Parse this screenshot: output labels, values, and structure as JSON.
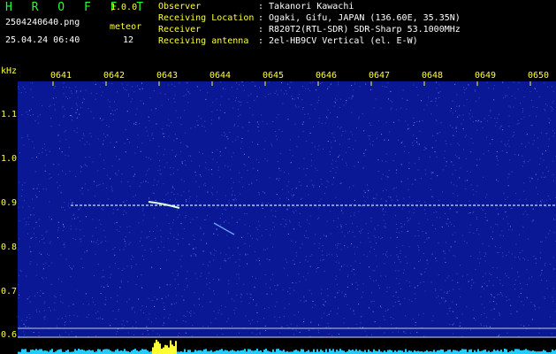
{
  "header": {
    "app_name": "H R O F F T",
    "version": "1.0.0",
    "filename": "2504240640.png",
    "meteor_label": "meteor",
    "datetime": "25.04.24 06:40",
    "meteor_count": "12",
    "info": [
      {
        "key": "Observer",
        "value": ": Takanori Kawachi"
      },
      {
        "key": "Receiving Location",
        "value": ": Ogaki, Gifu, JAPAN (136.60E, 35.35N)"
      },
      {
        "key": "Receiver",
        "value": ": R820T2(RTL-SDR) SDR-Sharp 53.1000MHz"
      },
      {
        "key": "Receiving antenna",
        "value": ": 2el-HB9CV Vertical (el. E-W)"
      }
    ]
  },
  "spectrogram": {
    "y_unit": "kHz",
    "time_ticks": [
      "0641",
      "0642",
      "0643",
      "0644",
      "0645",
      "0646",
      "0647",
      "0648",
      "0649",
      "0650"
    ],
    "freq_ticks": [
      "1.1",
      "1.0",
      "0.9",
      "0.8",
      "0.7",
      "0.6"
    ],
    "colors": {
      "background": "#0a1896",
      "noise": "#3050d0",
      "carrier": "#c8e8ff",
      "meteor": "#e0ffe0",
      "level": "#22ccff",
      "spike": "#ffff33"
    }
  }
}
